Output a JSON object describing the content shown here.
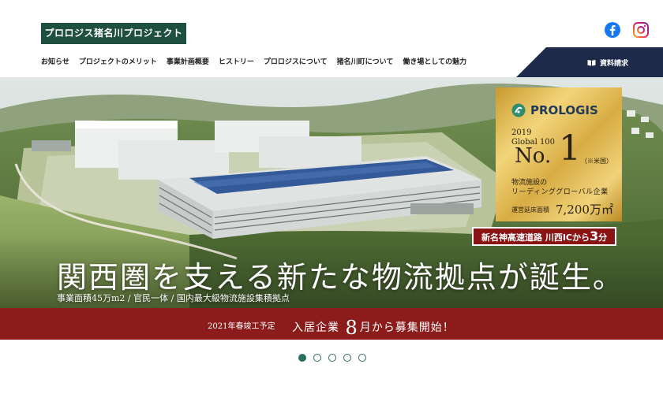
{
  "header": {
    "logo_text": "プロロジス猪名川プロジェクト",
    "social": [
      "facebook-icon",
      "instagram-icon"
    ],
    "doc_request": "資料請求"
  },
  "nav": [
    "お知らせ",
    "プロジェクトのメリット",
    "事業計画概要",
    "ヒストリー",
    "プロロジスについて",
    "猪名川町について",
    "働き場としての魅力"
  ],
  "hero": {
    "headline": "関西圏を支える新たな物流拠点が誕生。",
    "subline": "事業面積45万m2 / 官民一体 / 国内最大級物流施設集積拠点",
    "badge": {
      "brand": "PROLOGIS",
      "year": "2019",
      "global": "Global 100",
      "no": "No.",
      "rank": "1",
      "country": "（※米国）",
      "desc1": "物流施設の",
      "desc2": "リーディンググローバル企業",
      "area_label": "運営延床面積",
      "area_value": "7,200万㎡"
    },
    "access": {
      "prefix": "新名神高速道路 川西ICから",
      "minutes": "3",
      "unit": "分"
    }
  },
  "band": {
    "small": "2021年春竣工予定",
    "main_prefix": "入居企業",
    "month": "8",
    "main_suffix": "月から募集開始！"
  },
  "pager": {
    "count": 5,
    "active": 0
  },
  "colors": {
    "brand_green": "#1f4f3f",
    "navy": "#1d2a4a",
    "band_red": "#8c1b1b",
    "gold": "#d8ac44"
  }
}
